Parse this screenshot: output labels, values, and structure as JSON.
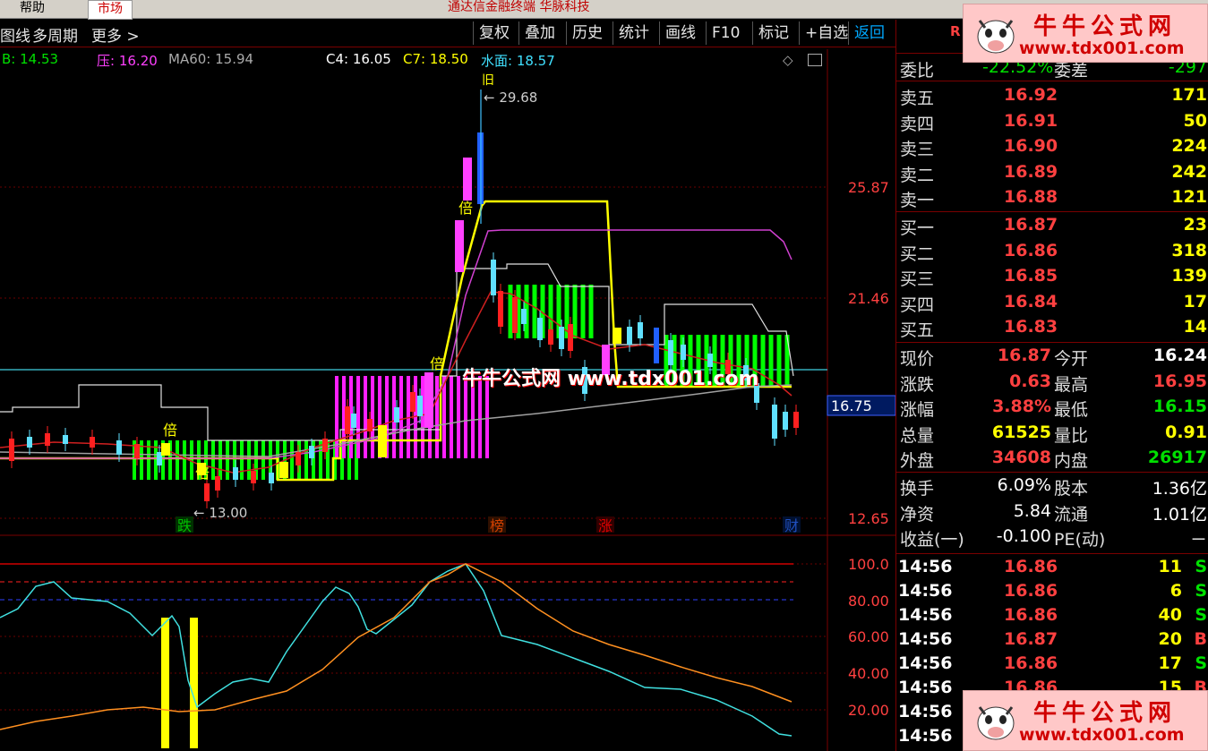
{
  "menu": {
    "help": "帮助",
    "market": "市场",
    "app_title": "通达信金融终端 华脉科技"
  },
  "toolbar": {
    "left": [
      "图线",
      "多周期",
      "更多 >"
    ],
    "buttons": [
      "复权",
      "叠加",
      "历史",
      "统计",
      "画线",
      "F10",
      "标记",
      "+自选",
      "返回"
    ]
  },
  "legend": {
    "b_label": "B:",
    "b_value": "14.53",
    "ya_label": "压:",
    "ya_value": "16.20",
    "ma60": "MA60: 15.94",
    "c4": "C4: 16.05",
    "c7": "C7: 18.50",
    "shuimian": "水面: 18.57"
  },
  "main_chart": {
    "y_labels": [
      "25.87",
      "21.46",
      "12.65"
    ],
    "price_tag": "16.75",
    "high_label": "29.68",
    "low_label": "13.00",
    "markers": [
      {
        "text": "跌",
        "color": "#00c000"
      },
      {
        "text": "榜",
        "color": "#d04000"
      },
      {
        "text": "涨",
        "color": "#e00000"
      },
      {
        "text": "财",
        "color": "#2050c0"
      }
    ],
    "bei": "倍",
    "jiu": "旧"
  },
  "sub_chart": {
    "y_labels": [
      "100.0",
      "80.00",
      "60.00",
      "40.00",
      "20.00"
    ]
  },
  "quote": {
    "header_left": "R",
    "weibi": {
      "label": "委比",
      "value": "-22.52%",
      "label2": "委差",
      "value2": "-297"
    },
    "sells": [
      {
        "label": "卖五",
        "price": "16.92",
        "vol": "171"
      },
      {
        "label": "卖四",
        "price": "16.91",
        "vol": "50"
      },
      {
        "label": "卖三",
        "price": "16.90",
        "vol": "224"
      },
      {
        "label": "卖二",
        "price": "16.89",
        "vol": "242"
      },
      {
        "label": "卖一",
        "price": "16.88",
        "vol": "121"
      }
    ],
    "buys": [
      {
        "label": "买一",
        "price": "16.87",
        "vol": "23"
      },
      {
        "label": "买二",
        "price": "16.86",
        "vol": "318"
      },
      {
        "label": "买三",
        "price": "16.85",
        "vol": "139"
      },
      {
        "label": "买四",
        "price": "16.84",
        "vol": "17"
      },
      {
        "label": "买五",
        "price": "16.83",
        "vol": "14"
      }
    ],
    "stats": [
      {
        "l1": "现价",
        "v1": "16.87",
        "c1": "#ff4040",
        "l2": "今开",
        "v2": "16.24",
        "c2": "#ffffff"
      },
      {
        "l1": "涨跌",
        "v1": "0.63",
        "c1": "#ff4040",
        "l2": "最高",
        "v2": "16.95",
        "c2": "#ff4040"
      },
      {
        "l1": "涨幅",
        "v1": "3.88%",
        "c1": "#ff4040",
        "l2": "最低",
        "v2": "16.15",
        "c2": "#00e000"
      },
      {
        "l1": "总量",
        "v1": "61525",
        "c1": "#ffff00",
        "l2": "量比",
        "v2": "0.91",
        "c2": "#ffff00"
      },
      {
        "l1": "外盘",
        "v1": "34608",
        "c1": "#ff4040",
        "l2": "内盘",
        "v2": "26917",
        "c2": "#00e000"
      }
    ],
    "stats2": [
      {
        "l1": "换手",
        "v1": "6.09%",
        "l2": "股本",
        "v2": "1.36亿"
      },
      {
        "l1": "净资",
        "v1": "5.84",
        "l2": "流通",
        "v2": "1.01亿"
      },
      {
        "l1": "收益(一)",
        "v1": "-0.100",
        "l2": "PE(动)",
        "v2": "－"
      }
    ],
    "ticks": [
      {
        "time": "14:56",
        "price": "16.86",
        "vol": "11",
        "side": "S"
      },
      {
        "time": "14:56",
        "price": "16.86",
        "vol": "6",
        "side": "S"
      },
      {
        "time": "14:56",
        "price": "16.86",
        "vol": "40",
        "side": "S"
      },
      {
        "time": "14:56",
        "price": "16.87",
        "vol": "20",
        "side": "B"
      },
      {
        "time": "14:56",
        "price": "16.86",
        "vol": "17",
        "side": "S"
      },
      {
        "time": "14:56",
        "price": "16.86",
        "vol": "15",
        "side": "B"
      },
      {
        "time": "14:56",
        "price": "",
        "vol": "",
        "side": ""
      },
      {
        "time": "14:56",
        "price": "",
        "vol": "",
        "side": ""
      }
    ]
  },
  "watermark": {
    "cn": "牛牛公式网",
    "url": "www.tdx001.com",
    "center": "牛牛公式网 www.tdx001.com"
  }
}
